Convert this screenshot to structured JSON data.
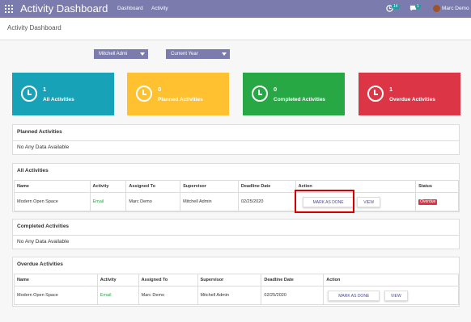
{
  "topbar": {
    "app_title": "Activity Dashboard",
    "nav": [
      "Dashboard",
      "Activity"
    ],
    "activity_count": "14",
    "message_count": "1",
    "user_name": "Marc Demo"
  },
  "breadcrumb": "Activity Dashboard",
  "filters": {
    "user": "Mitchell Admi",
    "period": "Current Year"
  },
  "cards": [
    {
      "count": "1",
      "label": "All Activities",
      "color": "#17a2b8"
    },
    {
      "count": "0",
      "label": "Planned Activities",
      "color": "#ffc12f"
    },
    {
      "count": "0",
      "label": "Completed Activities",
      "color": "#28a745"
    },
    {
      "count": "1",
      "label": "Overdue Activities",
      "color": "#dc3545"
    }
  ],
  "planned": {
    "title": "Planned Activities",
    "empty_text": "No Any Data Available"
  },
  "all": {
    "title": "All Activities",
    "columns": [
      "Name",
      "Activity",
      "Assigned To",
      "Supervisor",
      "Deadline Date",
      "Action",
      "Status"
    ],
    "rows": [
      {
        "name": "Modern Open Space",
        "activity": "Email",
        "assigned": "Marc Demo",
        "supervisor": "Mitchell Admin",
        "deadline": "02/25/2020",
        "done_label": "MARK AS DONE",
        "view_label": "VIEW",
        "status": "Overdue"
      }
    ]
  },
  "completed": {
    "title": "Completed Activities",
    "empty_text": "No Any Data Available"
  },
  "overdue": {
    "title": "Overdue Activities",
    "columns": [
      "Name",
      "Activity",
      "Assigned To",
      "Supervisor",
      "Deadline Date",
      "Action"
    ],
    "rows": [
      {
        "name": "Modern Open Space",
        "activity": "Email",
        "assigned": "Marc Demo",
        "supervisor": "Mitchell Admin",
        "deadline": "02/25/2020",
        "done_label": "MARK AS DONE",
        "view_label": "VIEW"
      }
    ]
  },
  "colors": {
    "topbar": "#7c7bad",
    "activity_green": "#28a745",
    "overdue_red": "#dc3545",
    "highlight": "#d70000"
  }
}
